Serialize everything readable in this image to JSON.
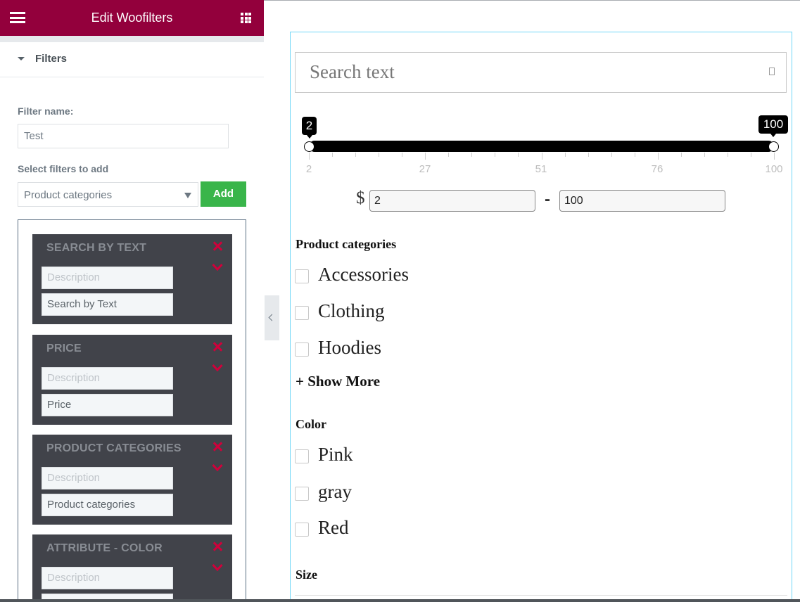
{
  "panel": {
    "title": "Edit Woofilters",
    "section_label": "Filters",
    "filter_name_label": "Filter name:",
    "filter_name_value": "Test",
    "select_label": "Select filters to add",
    "select_value": "Product categories",
    "add_label": "Add",
    "filters": [
      {
        "title": "SEARCH BY TEXT",
        "description_placeholder": "Description",
        "name": "Search by Text"
      },
      {
        "title": "PRICE",
        "description_placeholder": "Description",
        "name": "Price"
      },
      {
        "title": "PRODUCT CATEGORIES",
        "description_placeholder": "Description",
        "name": "Product categories"
      },
      {
        "title": "ATTRIBUTE - COLOR",
        "description_placeholder": "Description",
        "name": ""
      }
    ]
  },
  "preview": {
    "search_placeholder": "Search text",
    "slider": {
      "min_tip": "2",
      "max_tip": "100",
      "tick_labels": [
        "2",
        "27",
        "51",
        "76",
        "100"
      ]
    },
    "price": {
      "currency": "$",
      "min": "2",
      "max": "100",
      "separator": "-"
    },
    "categories": {
      "title": "Product categories",
      "items": [
        "Accessories",
        "Clothing",
        "Hoodies"
      ],
      "show_more": "+ Show More"
    },
    "color": {
      "title": "Color",
      "items": [
        "Pink",
        "gray",
        "Red"
      ]
    },
    "size": {
      "title": "Size"
    }
  },
  "colors": {
    "header": "#93003c",
    "add_button": "#39b54a",
    "card_bg": "#41434a",
    "card_action": "#d1003b",
    "preview_border": "#71d7f7"
  },
  "icons": [
    "hamburger-icon",
    "grid-icon",
    "caret-down-icon",
    "close-icon",
    "chevron-down-icon",
    "collapse-arrow-icon",
    "search-icon"
  ]
}
